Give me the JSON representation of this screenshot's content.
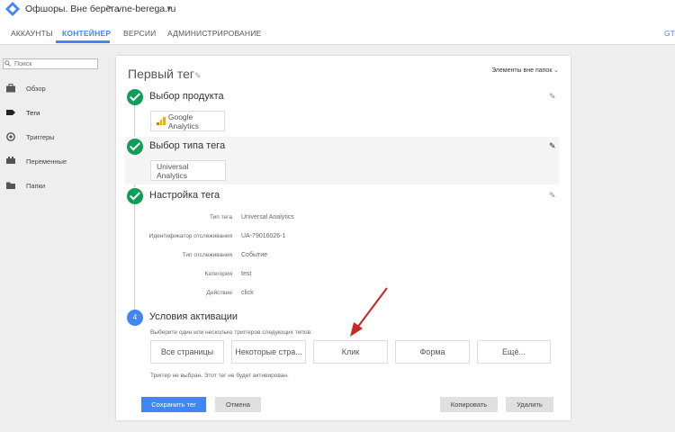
{
  "header": {
    "account": "Офшоры. Вне берега",
    "separator": ">",
    "container": "vne-berega.ru"
  },
  "nav": {
    "tabs": [
      {
        "label": "АККАУНТЫ"
      },
      {
        "label": "КОНТЕЙНЕР"
      },
      {
        "label": "ВЕРСИИ"
      },
      {
        "label": "АДМИНИСТРИРОВАНИЕ"
      }
    ],
    "right_label": "GTM",
    "active_tab": "КОНТЕЙНЕР"
  },
  "sidebar": {
    "search_placeholder": "Поиск",
    "items": [
      {
        "label": "Обзор",
        "icon": "briefcase-icon"
      },
      {
        "label": "Теги",
        "icon": "tag-icon"
      },
      {
        "label": "Триггеры",
        "icon": "trigger-icon"
      },
      {
        "label": "Переменные",
        "icon": "variables-icon"
      },
      {
        "label": "Папки",
        "icon": "folder-icon"
      }
    ],
    "active_item": "Теги"
  },
  "tag": {
    "title": "Первый тег",
    "folders_label": "Элементы вне папок",
    "steps": {
      "product": {
        "title": "Выбор продукта",
        "value": "Google Analytics"
      },
      "tag_type": {
        "title": "Выбор типа тега",
        "value": "Universal Analytics"
      },
      "config": {
        "title": "Настройка тега",
        "fields": [
          {
            "label": "Тип тега",
            "value": "Universal Analytics"
          },
          {
            "label": "Идентификатор отслеживания",
            "value": "UA-79016026-1"
          },
          {
            "label": "Тип отслеживания",
            "value": "Событие"
          },
          {
            "label": "Категория",
            "value": "test"
          },
          {
            "label": "Действие",
            "value": "click"
          }
        ]
      },
      "triggers": {
        "number": "4",
        "title": "Условия активации",
        "hint": "Выберите один или несколько триггеров следующих типов:",
        "options": [
          {
            "label": "Все страницы"
          },
          {
            "label": "Некоторые стра..."
          },
          {
            "label": "Клик"
          },
          {
            "label": "Форма"
          },
          {
            "label": "Ещё..."
          }
        ],
        "status": "Триггер не выбран. Этот тег не будет активирован."
      }
    }
  },
  "actions": {
    "save": "Сохранить тег",
    "cancel": "Отмена",
    "copy": "Копировать",
    "delete": "Удалить"
  },
  "colors": {
    "accent": "#4285f4",
    "success": "#0f9d58",
    "arrow": "#c62828"
  }
}
